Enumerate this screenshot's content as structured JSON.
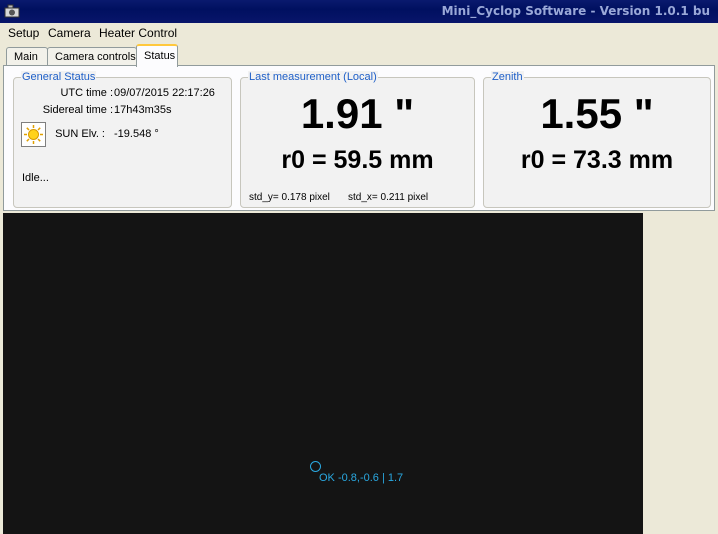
{
  "window": {
    "title": "Mini_Cyclop Software - Version 1.0.1 bu"
  },
  "menu": {
    "setup": "Setup",
    "camera": "Camera",
    "heater": "Heater Control"
  },
  "tabs": {
    "main": "Main",
    "camera_controls": "Camera controls",
    "status": "Status"
  },
  "general_status": {
    "label": "General Status",
    "utc_label": "UTC time :",
    "utc_value": "09/07/2015 22:17:26",
    "sidereal_label": "Sidereal time :",
    "sidereal_value": "17h43m35s",
    "sun_label": "SUN Elv. :",
    "sun_value": "-19.548 °",
    "state": "Idle..."
  },
  "last_measurement": {
    "label": "Last measurement (Local)",
    "seeing": "1.91 \"",
    "r0": "r0 = 59.5 mm",
    "std_y": "std_y= 0.178 pixel",
    "std_x": "std_x= 0.211 pixel"
  },
  "zenith": {
    "label": "Zenith",
    "seeing": "1.55 \"",
    "r0": "r0 = 73.3 mm"
  },
  "viewport": {
    "star_label": "OK -0.8,-0.6 | 1.7"
  },
  "colors": {
    "accent": "#2060c8",
    "overlay": "#2aa8e0",
    "image_bg": "#141414"
  }
}
